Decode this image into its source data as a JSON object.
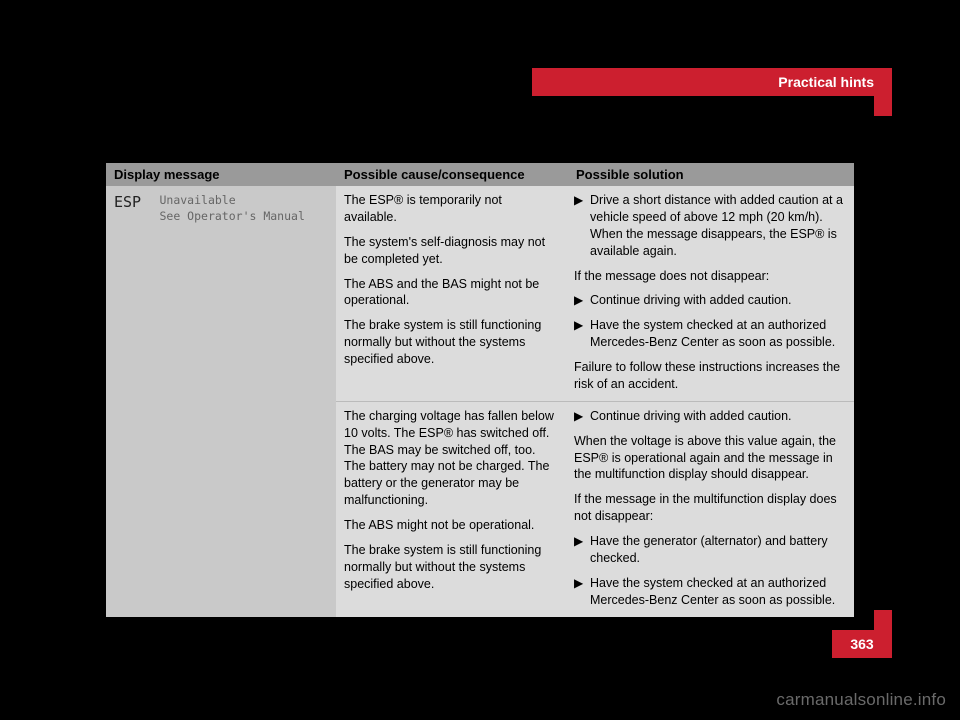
{
  "header": {
    "section_title": "Practical hints"
  },
  "table": {
    "headers": {
      "message": "Display message",
      "cause": "Possible cause/consequence",
      "solution": "Possible solution"
    },
    "message": {
      "code": "ESP",
      "line1": "Unavailable",
      "line2": "See Operator's Manual"
    },
    "rows": [
      {
        "cause": [
          "The ESP® is temporarily not available.",
          "The system's self-diagnosis may not be completed yet.",
          "The ABS and the BAS might not be operational.",
          "The brake system is still functioning normally but without the systems specified above."
        ],
        "solution": {
          "bullets1": [
            "Drive a short distance with added caution at a vehicle speed of above 12 mph (20 km/h). When the message disappears, the ESP® is available again."
          ],
          "mid_text": "If the message does not disappear:",
          "bullets2": [
            "Continue driving with added caution.",
            "Have the system checked at an authorized Mercedes-Benz Center as soon as possible."
          ],
          "tail_text": "Failure to follow these instructions increases the risk of an accident."
        }
      },
      {
        "cause": [
          "The charging voltage has fallen below 10 volts. The ESP® has switched off. The BAS may be switched off, too. The battery may not be charged. The battery or the generator may be malfunctioning.",
          "The ABS might not be operational.",
          "The brake system is still functioning normally but without the systems specified above."
        ],
        "solution": {
          "bullets1": [
            "Continue driving with added caution."
          ],
          "mid_text": "When the voltage is above this value again, the ESP® is operational again and the message in the multifunction display should disappear.",
          "mid_text2": "If the message in the multifunction display does not disappear:",
          "bullets2": [
            "Have the generator (alternator) and battery checked.",
            "Have the system checked at an authorized Mercedes-Benz Center as soon as possible."
          ]
        }
      }
    ]
  },
  "page_number": "363",
  "watermark": "carmanualsonline.info",
  "glyphs": {
    "bullet": "▶"
  }
}
